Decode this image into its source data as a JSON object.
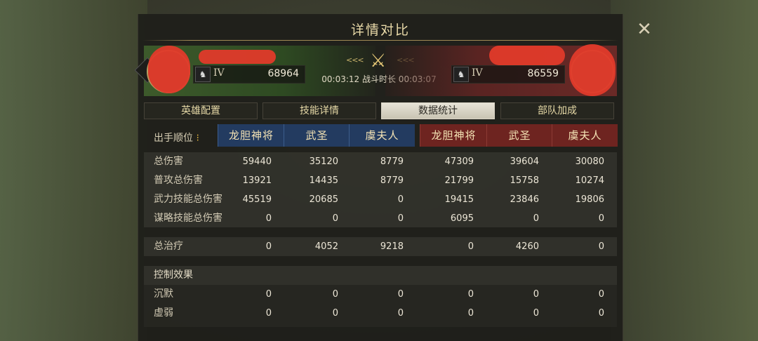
{
  "title": "详情对比",
  "header": {
    "left": {
      "tier": "IV",
      "power": "68964"
    },
    "right": {
      "tier": "IV",
      "power": "86559"
    },
    "battle_time": "00:03:12 战斗时长 00:03:07",
    "colors": {
      "left_team": "#3d5a2b",
      "right_team": "#6a2a27"
    }
  },
  "tabs": [
    {
      "label": "英雄配置",
      "active": false
    },
    {
      "label": "技能详情",
      "active": false
    },
    {
      "label": "数据统计",
      "active": true
    },
    {
      "label": "部队加成",
      "active": false
    }
  ],
  "table": {
    "order_label": "出手顺位",
    "order_mark": "⁝",
    "heroes": [
      {
        "name": "龙胆神将",
        "side": "blue"
      },
      {
        "name": "武圣",
        "side": "blue"
      },
      {
        "name": "虞夫人",
        "side": "blue"
      },
      {
        "name": "龙胆神将",
        "side": "red"
      },
      {
        "name": "武圣",
        "side": "red"
      },
      {
        "name": "虞夫人",
        "side": "red"
      }
    ],
    "rows": [
      {
        "label": "总伤害",
        "values": [
          "59440",
          "35120",
          "8779",
          "47309",
          "39604",
          "30080"
        ]
      },
      {
        "label": "普攻总伤害",
        "values": [
          "13921",
          "14435",
          "8779",
          "21799",
          "15758",
          "10274"
        ]
      },
      {
        "label": "武力技能总伤害",
        "values": [
          "45519",
          "20685",
          "0",
          "19415",
          "23846",
          "19806"
        ]
      },
      {
        "label": "谋略技能总伤害",
        "values": [
          "0",
          "0",
          "0",
          "6095",
          "0",
          "0"
        ]
      },
      {
        "label": "总治疗",
        "values": [
          "0",
          "4052",
          "9218",
          "0",
          "4260",
          "0"
        ]
      },
      {
        "label": "控制效果",
        "values": []
      },
      {
        "label": "沉默",
        "values": [
          "0",
          "0",
          "0",
          "0",
          "0",
          "0"
        ]
      },
      {
        "label": "虚弱",
        "values": [
          "0",
          "0",
          "0",
          "0",
          "0",
          "0"
        ]
      }
    ]
  },
  "icons": {
    "close": "close-icon",
    "horse": "horse-icon",
    "swords": "crossed-swords-icon"
  }
}
